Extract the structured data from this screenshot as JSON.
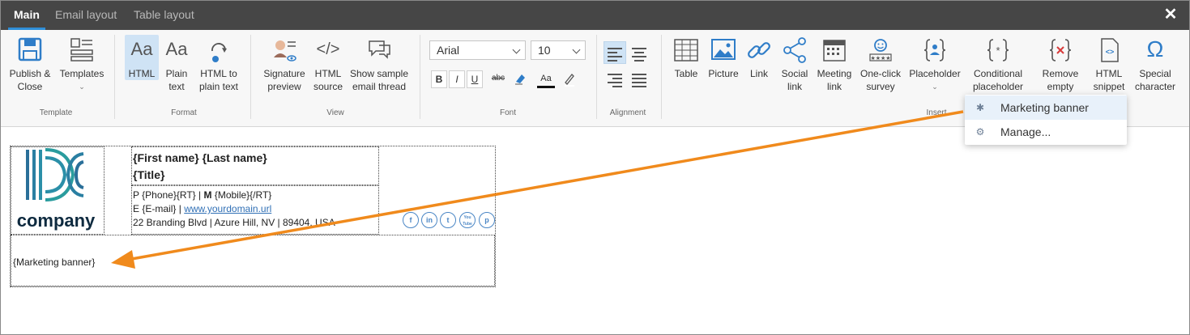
{
  "tabs": [
    {
      "label": "Main",
      "active": true
    },
    {
      "label": "Email layout",
      "active": false
    },
    {
      "label": "Table layout",
      "active": false
    }
  ],
  "close_icon": "close-icon",
  "ribbon": {
    "groups": [
      {
        "label": "Template"
      },
      {
        "label": "Format"
      },
      {
        "label": "View"
      },
      {
        "label": "Font"
      },
      {
        "label": "Alignment"
      },
      {
        "label": "Insert"
      }
    ],
    "template": {
      "publish_line1": "Publish &",
      "publish_line2": "Close",
      "templates": "Templates"
    },
    "format": {
      "html": "HTML",
      "plain_line1": "Plain",
      "plain_line2": "text",
      "h2p_line1": "HTML to",
      "h2p_line2": "plain text",
      "aa": "Aa"
    },
    "view": {
      "sig_line1": "Signature",
      "sig_line2": "preview",
      "src_line1": "HTML",
      "src_line2": "source",
      "thread_line1": "Show sample",
      "thread_line2": "email thread"
    },
    "font": {
      "family": "Arial",
      "size": "10",
      "bold": "B",
      "italic": "I",
      "underline": "U",
      "strike": "abc",
      "aa": "Aa"
    },
    "insert": {
      "table": "Table",
      "picture": "Picture",
      "link": "Link",
      "social_line1": "Social",
      "social_line2": "link",
      "meeting_line1": "Meeting",
      "meeting_line2": "link",
      "survey_line1": "One-click",
      "survey_line2": "survey",
      "placeholder": "Placeholder",
      "cond_line1": "Conditional",
      "cond_line2": "placeholder",
      "remove_line1": "Remove",
      "remove_line2": "empty",
      "snippet_line1": "HTML",
      "snippet_line2": "snippet",
      "special_line1": "Special",
      "special_line2": "character"
    }
  },
  "menu": {
    "items": [
      {
        "label": "Marketing banner",
        "icon": "asterisk-icon"
      },
      {
        "label": "Manage...",
        "icon": "gear-icon"
      }
    ]
  },
  "signature": {
    "logo_text": "company",
    "name": "{First name} {Last name}",
    "title": "{Title}",
    "phone_prefix": "P",
    "phone": "{Phone}{RT}",
    "sep": "|",
    "mobile_prefix": "M",
    "mobile": "{Mobile}{/RT}",
    "email_prefix": "E",
    "email": "{E-mail}",
    "website": "www.yourdomain.url",
    "address": "22 Branding Blvd | Azure Hill, NV | 89404, USA",
    "social": [
      "f",
      "in",
      "t",
      "You Tube",
      "p"
    ],
    "banner": "{Marketing banner}"
  },
  "colors": {
    "accent": "#2f8fd8",
    "arrow": "#f08a1c",
    "topbar": "#464646"
  }
}
